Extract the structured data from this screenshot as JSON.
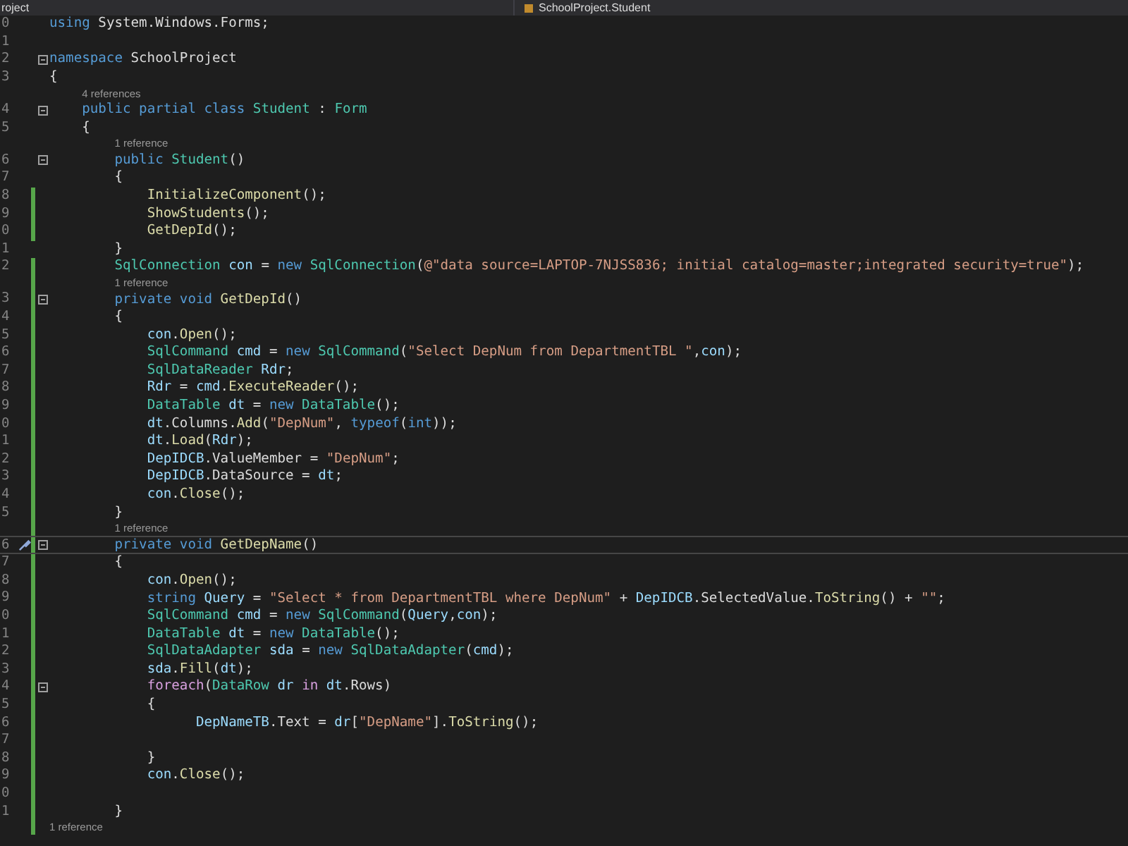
{
  "header": {
    "project": "roject",
    "scope": "SchoolProject.Student"
  },
  "lines": [
    {
      "kind": "code",
      "number": "0",
      "changed": false,
      "fold": false,
      "current": false,
      "tokens": [
        {
          "text": "using",
          "kind": "kw"
        },
        {
          "text": " System.Windows.Forms;",
          "kind": "plain"
        }
      ]
    },
    {
      "kind": "code",
      "number": "1",
      "changed": false,
      "fold": false,
      "current": false
    },
    {
      "kind": "code",
      "number": "2",
      "changed": false,
      "fold": true,
      "current": false,
      "tokens": [
        {
          "text": "namespace",
          "kind": "kw"
        },
        {
          "text": " SchoolProject",
          "kind": "plain"
        }
      ]
    },
    {
      "kind": "code",
      "number": "3",
      "changed": false,
      "fold": false,
      "current": false,
      "tokens": [
        {
          "text": "{",
          "kind": "plain"
        }
      ]
    },
    {
      "kind": "reference",
      "text": "4 references",
      "changed": false
    },
    {
      "kind": "code",
      "number": "4",
      "changed": false,
      "fold": true,
      "current": false,
      "tokens": [
        {
          "text": "    public partial class",
          "kind": "kw"
        },
        {
          "text": " Student",
          "kind": "type"
        },
        {
          "text": " : ",
          "kind": "plain"
        },
        {
          "text": "Form",
          "kind": "type"
        }
      ]
    },
    {
      "kind": "code",
      "number": "5",
      "changed": false,
      "fold": false,
      "current": false,
      "tokens": [
        {
          "text": "    {",
          "kind": "plain"
        }
      ]
    },
    {
      "kind": "reference",
      "text": "1 reference",
      "changed": false
    },
    {
      "kind": "code",
      "number": "6",
      "changed": false,
      "fold": true,
      "current": false,
      "tokens": [
        {
          "text": "        public",
          "kind": "kw"
        },
        {
          "text": " Student",
          "kind": "type"
        },
        {
          "text": "()",
          "kind": "plain"
        }
      ]
    },
    {
      "kind": "code",
      "number": "7",
      "changed": false,
      "fold": false,
      "current": false,
      "tokens": [
        {
          "text": "        {",
          "kind": "plain"
        }
      ]
    },
    {
      "kind": "code",
      "number": "8",
      "changed": true,
      "fold": false,
      "current": false,
      "tokens": [
        {
          "text": "            InitializeComponent",
          "kind": "fn"
        },
        {
          "text": "();",
          "kind": "plain"
        }
      ]
    },
    {
      "kind": "code",
      "number": "9",
      "changed": true,
      "fold": false,
      "current": false,
      "tokens": [
        {
          "text": "            ShowStudents",
          "kind": "fn"
        },
        {
          "text": "();",
          "kind": "plain"
        }
      ]
    },
    {
      "kind": "code",
      "number": "0",
      "changed": true,
      "fold": false,
      "current": false,
      "tokens": [
        {
          "text": "            GetDepId",
          "kind": "fn"
        },
        {
          "text": "();",
          "kind": "plain"
        }
      ]
    },
    {
      "kind": "code",
      "number": "1",
      "changed": false,
      "fold": false,
      "current": false,
      "tokens": [
        {
          "text": "        }",
          "kind": "plain"
        }
      ]
    },
    {
      "kind": "code",
      "number": "2",
      "changed": true,
      "fold": false,
      "current": false,
      "tokens": [
        {
          "text": "        SqlConnection",
          "kind": "type"
        },
        {
          "text": " con",
          "kind": "var"
        },
        {
          "text": " = ",
          "kind": "plain"
        },
        {
          "text": "new",
          "kind": "kw"
        },
        {
          "text": " SqlConnection",
          "kind": "type"
        },
        {
          "text": "(",
          "kind": "plain"
        },
        {
          "text": "@\"data source=LAPTOP-7NJSS836; initial catalog=master;integrated security=true\"",
          "kind": "str"
        },
        {
          "text": ");",
          "kind": "plain"
        }
      ]
    },
    {
      "kind": "reference",
      "text": "1 reference",
      "changed": true
    },
    {
      "kind": "code",
      "number": "3",
      "changed": true,
      "fold": true,
      "current": false,
      "tokens": [
        {
          "text": "        private void",
          "kind": "kw"
        },
        {
          "text": " GetDepId",
          "kind": "fn"
        },
        {
          "text": "()",
          "kind": "plain"
        }
      ]
    },
    {
      "kind": "code",
      "number": "4",
      "changed": true,
      "fold": false,
      "current": false,
      "tokens": [
        {
          "text": "        {",
          "kind": "plain"
        }
      ]
    },
    {
      "kind": "code",
      "number": "5",
      "changed": true,
      "fold": false,
      "current": false,
      "tokens": [
        {
          "text": "            con",
          "kind": "var"
        },
        {
          "text": ".",
          "kind": "plain"
        },
        {
          "text": "Open",
          "kind": "fn"
        },
        {
          "text": "();",
          "kind": "plain"
        }
      ]
    },
    {
      "kind": "code",
      "number": "6",
      "changed": true,
      "fold": false,
      "current": false,
      "tokens": [
        {
          "text": "            SqlCommand",
          "kind": "type"
        },
        {
          "text": " cmd",
          "kind": "var"
        },
        {
          "text": " = ",
          "kind": "plain"
        },
        {
          "text": "new",
          "kind": "kw"
        },
        {
          "text": " SqlCommand",
          "kind": "type"
        },
        {
          "text": "(",
          "kind": "plain"
        },
        {
          "text": "\"Select DepNum from DepartmentTBL \"",
          "kind": "str"
        },
        {
          "text": ",",
          "kind": "plain"
        },
        {
          "text": "con",
          "kind": "var"
        },
        {
          "text": ");",
          "kind": "plain"
        }
      ]
    },
    {
      "kind": "code",
      "number": "7",
      "changed": true,
      "fold": false,
      "current": false,
      "tokens": [
        {
          "text": "            SqlDataReader",
          "kind": "type"
        },
        {
          "text": " Rdr",
          "kind": "var"
        },
        {
          "text": ";",
          "kind": "plain"
        }
      ]
    },
    {
      "kind": "code",
      "number": "8",
      "changed": true,
      "fold": false,
      "current": false,
      "tokens": [
        {
          "text": "            Rdr",
          "kind": "var"
        },
        {
          "text": " = ",
          "kind": "plain"
        },
        {
          "text": "cmd",
          "kind": "var"
        },
        {
          "text": ".",
          "kind": "plain"
        },
        {
          "text": "ExecuteReader",
          "kind": "fn"
        },
        {
          "text": "();",
          "kind": "plain"
        }
      ]
    },
    {
      "kind": "code",
      "number": "9",
      "changed": true,
      "fold": false,
      "current": false,
      "tokens": [
        {
          "text": "            DataTable",
          "kind": "type"
        },
        {
          "text": " dt",
          "kind": "var"
        },
        {
          "text": " = ",
          "kind": "plain"
        },
        {
          "text": "new",
          "kind": "kw"
        },
        {
          "text": " DataTable",
          "kind": "type"
        },
        {
          "text": "();",
          "kind": "plain"
        }
      ]
    },
    {
      "kind": "code",
      "number": "0",
      "changed": true,
      "fold": false,
      "current": false,
      "tokens": [
        {
          "text": "            dt",
          "kind": "var"
        },
        {
          "text": ".Columns.",
          "kind": "plain"
        },
        {
          "text": "Add",
          "kind": "fn"
        },
        {
          "text": "(",
          "kind": "plain"
        },
        {
          "text": "\"DepNum\"",
          "kind": "str"
        },
        {
          "text": ", ",
          "kind": "plain"
        },
        {
          "text": "typeof",
          "kind": "kw"
        },
        {
          "text": "(",
          "kind": "plain"
        },
        {
          "text": "int",
          "kind": "kw"
        },
        {
          "text": "));",
          "kind": "plain"
        }
      ]
    },
    {
      "kind": "code",
      "number": "1",
      "changed": true,
      "fold": false,
      "current": false,
      "tokens": [
        {
          "text": "            dt",
          "kind": "var"
        },
        {
          "text": ".",
          "kind": "plain"
        },
        {
          "text": "Load",
          "kind": "fn"
        },
        {
          "text": "(",
          "kind": "plain"
        },
        {
          "text": "Rdr",
          "kind": "var"
        },
        {
          "text": ");",
          "kind": "plain"
        }
      ]
    },
    {
      "kind": "code",
      "number": "2",
      "changed": true,
      "fold": false,
      "current": false,
      "tokens": [
        {
          "text": "            DepIDCB",
          "kind": "var"
        },
        {
          "text": ".ValueMember = ",
          "kind": "plain"
        },
        {
          "text": "\"DepNum\"",
          "kind": "str"
        },
        {
          "text": ";",
          "kind": "plain"
        }
      ]
    },
    {
      "kind": "code",
      "number": "3",
      "changed": true,
      "fold": false,
      "current": false,
      "tokens": [
        {
          "text": "            DepIDCB",
          "kind": "var"
        },
        {
          "text": ".DataSource = ",
          "kind": "plain"
        },
        {
          "text": "dt",
          "kind": "var"
        },
        {
          "text": ";",
          "kind": "plain"
        }
      ]
    },
    {
      "kind": "code",
      "number": "4",
      "changed": true,
      "fold": false,
      "current": false,
      "tokens": [
        {
          "text": "            con",
          "kind": "var"
        },
        {
          "text": ".",
          "kind": "plain"
        },
        {
          "text": "Close",
          "kind": "fn"
        },
        {
          "text": "();",
          "kind": "plain"
        }
      ]
    },
    {
      "kind": "code",
      "number": "5",
      "changed": true,
      "fold": false,
      "current": false,
      "tokens": [
        {
          "text": "        }",
          "kind": "plain"
        }
      ]
    },
    {
      "kind": "reference",
      "text": "1 reference",
      "changed": true
    },
    {
      "kind": "code",
      "number": "6",
      "changed": true,
      "fold": true,
      "current": true,
      "tokens": [
        {
          "text": "        private void",
          "kind": "kw"
        },
        {
          "text": " GetDepName",
          "kind": "fn"
        },
        {
          "text": "()",
          "kind": "plain"
        }
      ]
    },
    {
      "kind": "code",
      "number": "7",
      "changed": true,
      "fold": false,
      "current": false,
      "tokens": [
        {
          "text": "        {",
          "kind": "plain"
        }
      ]
    },
    {
      "kind": "code",
      "number": "8",
      "changed": true,
      "fold": false,
      "current": false,
      "tokens": [
        {
          "text": "            con",
          "kind": "var"
        },
        {
          "text": ".",
          "kind": "plain"
        },
        {
          "text": "Open",
          "kind": "fn"
        },
        {
          "text": "();",
          "kind": "plain"
        }
      ]
    },
    {
      "kind": "code",
      "number": "9",
      "changed": true,
      "fold": false,
      "current": false,
      "tokens": [
        {
          "text": "            string",
          "kind": "kw"
        },
        {
          "text": " Query",
          "kind": "var"
        },
        {
          "text": " = ",
          "kind": "plain"
        },
        {
          "text": "\"Select * from DepartmentTBL where DepNum\"",
          "kind": "str"
        },
        {
          "text": " + ",
          "kind": "plain"
        },
        {
          "text": "DepIDCB",
          "kind": "var"
        },
        {
          "text": ".SelectedValue.",
          "kind": "plain"
        },
        {
          "text": "ToString",
          "kind": "fn"
        },
        {
          "text": "() + ",
          "kind": "plain"
        },
        {
          "text": "\"\"",
          "kind": "str"
        },
        {
          "text": ";",
          "kind": "plain"
        }
      ]
    },
    {
      "kind": "code",
      "number": "0",
      "changed": true,
      "fold": false,
      "current": false,
      "tokens": [
        {
          "text": "            SqlCommand",
          "kind": "type"
        },
        {
          "text": " cmd",
          "kind": "var"
        },
        {
          "text": " = ",
          "kind": "plain"
        },
        {
          "text": "new",
          "kind": "kw"
        },
        {
          "text": " SqlCommand",
          "kind": "type"
        },
        {
          "text": "(",
          "kind": "plain"
        },
        {
          "text": "Query",
          "kind": "var"
        },
        {
          "text": ",",
          "kind": "plain"
        },
        {
          "text": "con",
          "kind": "var"
        },
        {
          "text": ");",
          "kind": "plain"
        }
      ]
    },
    {
      "kind": "code",
      "number": "1",
      "changed": true,
      "fold": false,
      "current": false,
      "tokens": [
        {
          "text": "            DataTable",
          "kind": "type"
        },
        {
          "text": " dt",
          "kind": "var"
        },
        {
          "text": " = ",
          "kind": "plain"
        },
        {
          "text": "new",
          "kind": "kw"
        },
        {
          "text": " DataTable",
          "kind": "type"
        },
        {
          "text": "();",
          "kind": "plain"
        }
      ]
    },
    {
      "kind": "code",
      "number": "2",
      "changed": true,
      "fold": false,
      "current": false,
      "tokens": [
        {
          "text": "            SqlDataAdapter",
          "kind": "type"
        },
        {
          "text": " sda",
          "kind": "var"
        },
        {
          "text": " = ",
          "kind": "plain"
        },
        {
          "text": "new",
          "kind": "kw"
        },
        {
          "text": " SqlDataAdapter",
          "kind": "type"
        },
        {
          "text": "(",
          "kind": "plain"
        },
        {
          "text": "cmd",
          "kind": "var"
        },
        {
          "text": ");",
          "kind": "plain"
        }
      ]
    },
    {
      "kind": "code",
      "number": "3",
      "changed": true,
      "fold": false,
      "current": false,
      "tokens": [
        {
          "text": "            sda",
          "kind": "var"
        },
        {
          "text": ".",
          "kind": "plain"
        },
        {
          "text": "Fill",
          "kind": "fn"
        },
        {
          "text": "(",
          "kind": "plain"
        },
        {
          "text": "dt",
          "kind": "var"
        },
        {
          "text": ");",
          "kind": "plain"
        }
      ]
    },
    {
      "kind": "code",
      "number": "4",
      "changed": true,
      "fold": true,
      "current": false,
      "tokens": [
        {
          "text": "            foreach",
          "kind": "ctrl"
        },
        {
          "text": "(",
          "kind": "plain"
        },
        {
          "text": "DataRow",
          "kind": "type"
        },
        {
          "text": " dr",
          "kind": "var"
        },
        {
          "text": " in",
          "kind": "ctrl"
        },
        {
          "text": " dt",
          "kind": "var"
        },
        {
          "text": ".Rows)",
          "kind": "plain"
        }
      ]
    },
    {
      "kind": "code",
      "number": "5",
      "changed": true,
      "fold": false,
      "current": false,
      "tokens": [
        {
          "text": "            {",
          "kind": "plain"
        }
      ]
    },
    {
      "kind": "code",
      "number": "6",
      "changed": true,
      "fold": false,
      "current": false,
      "tokens": [
        {
          "text": "                  DepNameTB",
          "kind": "var"
        },
        {
          "text": ".Text = ",
          "kind": "plain"
        },
        {
          "text": "dr",
          "kind": "var"
        },
        {
          "text": "[",
          "kind": "plain"
        },
        {
          "text": "\"DepName\"",
          "kind": "str"
        },
        {
          "text": "].",
          "kind": "plain"
        },
        {
          "text": "ToString",
          "kind": "fn"
        },
        {
          "text": "();",
          "kind": "plain"
        }
      ]
    },
    {
      "kind": "code",
      "number": "7",
      "changed": true,
      "fold": false,
      "current": false
    },
    {
      "kind": "code",
      "number": "8",
      "changed": true,
      "fold": false,
      "current": false,
      "tokens": [
        {
          "text": "            }",
          "kind": "plain"
        }
      ]
    },
    {
      "kind": "code",
      "number": "9",
      "changed": true,
      "fold": false,
      "current": false,
      "tokens": [
        {
          "text": "            con",
          "kind": "var"
        },
        {
          "text": ".",
          "kind": "plain"
        },
        {
          "text": "Close",
          "kind": "fn"
        },
        {
          "text": "();",
          "kind": "plain"
        }
      ]
    },
    {
      "kind": "code",
      "number": "0",
      "changed": true,
      "fold": false,
      "current": false
    },
    {
      "kind": "code",
      "number": "1",
      "changed": true,
      "fold": false,
      "current": false,
      "tokens": [
        {
          "text": "        }",
          "kind": "plain"
        }
      ]
    },
    {
      "kind": "reference",
      "text": "1 reference",
      "changed": true
    }
  ]
}
